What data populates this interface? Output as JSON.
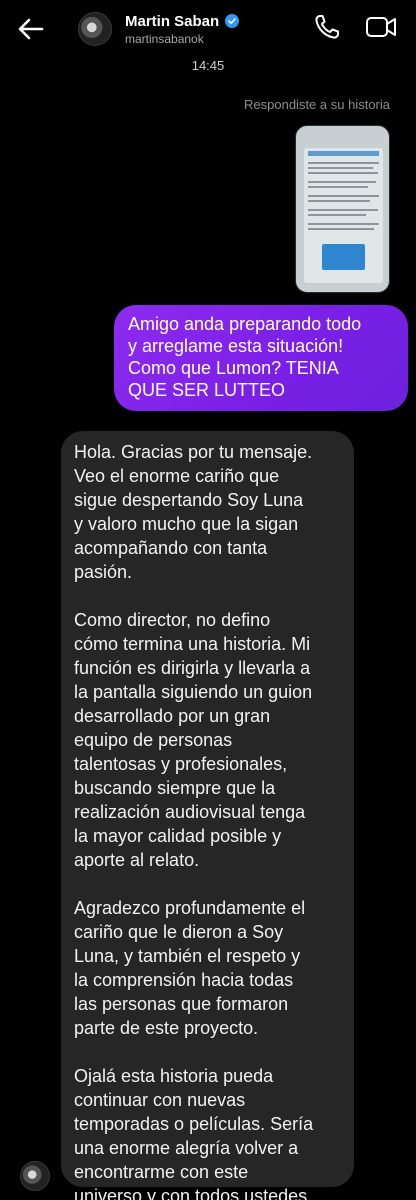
{
  "header": {
    "name": "Martin Saban",
    "username": "martinsabanok",
    "back_icon": "arrow-left-icon",
    "verified_icon": "verified-badge-icon",
    "call_icon": "phone-icon",
    "video_icon": "video-camera-icon"
  },
  "timestamp": "14:45",
  "story_reply_label": "Respondiste a su historia",
  "messages": {
    "sent": "Amigo anda preparando todo\ny arreglame esta situación!\nComo que Lumon? TENIA\nQUE SER LUTTEO",
    "received": "Hola. Gracias por tu mensaje.\nVeo el enorme cariño que\nsigue despertando Soy Luna\ny valoro mucho que la sigan\nacompañando con tanta\npasión.\n\nComo director, no defino\ncómo termina una historia. Mi\nfunción es dirigirla y llevarla a\nla pantalla siguiendo un guion\ndesarrollado por un gran\nequipo de personas\ntalentosas y profesionales,\nbuscando siempre que la\nrealización audiovisual tenga\nla mayor calidad posible y\naporte al relato.\n\nAgradezco profundamente el\ncariño que le dieron a Soy\nLuna, y también el respeto y\nla comprensión hacia todas\nlas personas que formaron\nparte de este proyecto.\n\nOjalá esta historia pueda\ncontinuar con nuevas\ntemporadas o películas. Sería\nuna enorme alegría volver a\nencontrarme con este\nuniverso y con todos ustedes."
  },
  "colors": {
    "background": "#000000",
    "sent_bubble": "#7a1fe6",
    "received_bubble": "#262626",
    "verified": "#3897f0"
  }
}
